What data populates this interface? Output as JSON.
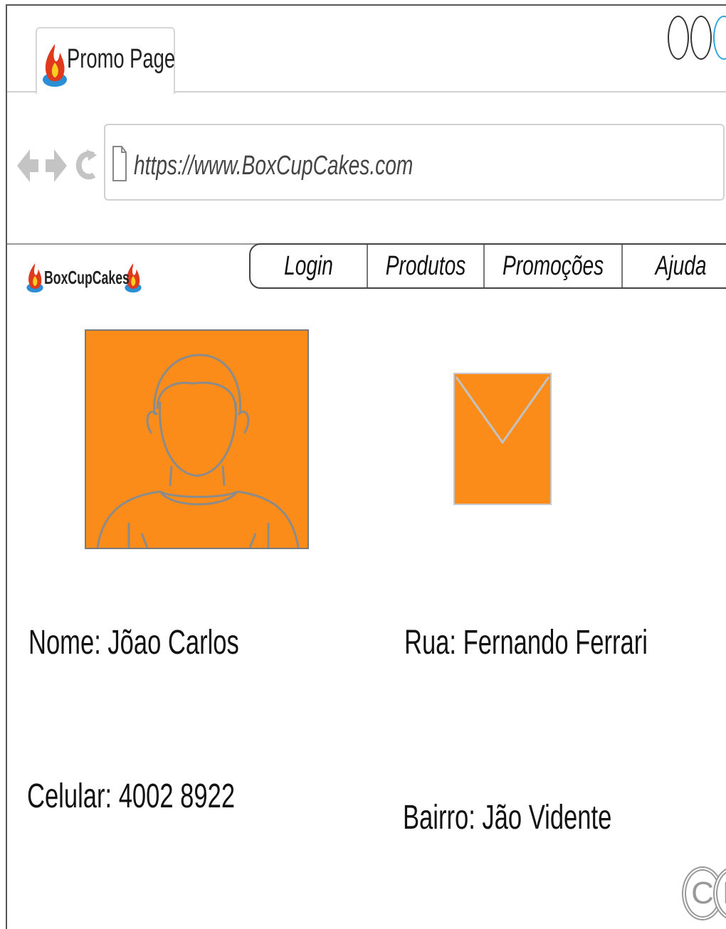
{
  "browser": {
    "tab_title": "Promo Page",
    "url": "https://www.BoxCupCakes.com",
    "nav_icons": [
      "back-arrow-icon",
      "forward-arrow-icon",
      "reload-icon",
      "page-icon"
    ],
    "window_controls": [
      "minimize",
      "maximize",
      "close"
    ]
  },
  "site": {
    "logo_text": "BoxCupCakes",
    "menu": [
      {
        "label": "Login"
      },
      {
        "label": "Produtos"
      },
      {
        "label": "Promoções"
      },
      {
        "label": "Ajuda"
      }
    ]
  },
  "profile": {
    "name": "Nome: Jõao Carlos",
    "street": "Rua: Fernando Ferrari",
    "phone": "Celular: 4002 8922",
    "district": "Bairro: Jão Vidente"
  },
  "colors": {
    "accent": "#fb8c1a",
    "border": "#d0d0d0",
    "icon_gray": "#c4c4c4"
  },
  "footer": {
    "mark": "CR"
  }
}
